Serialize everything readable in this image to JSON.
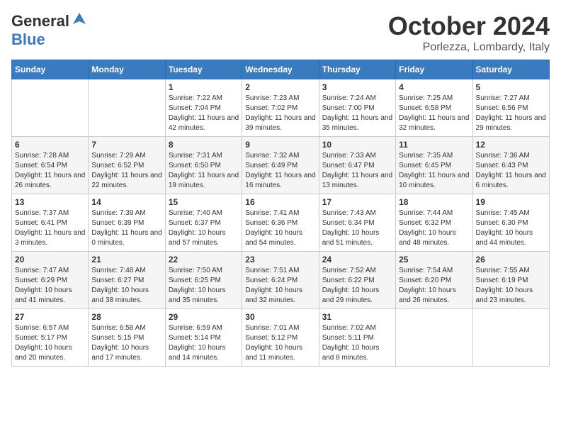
{
  "logo": {
    "general": "General",
    "blue": "Blue"
  },
  "title": "October 2024",
  "location": "Porlezza, Lombardy, Italy",
  "days": [
    "Sunday",
    "Monday",
    "Tuesday",
    "Wednesday",
    "Thursday",
    "Friday",
    "Saturday"
  ],
  "weeks": [
    [
      {
        "day": "",
        "content": ""
      },
      {
        "day": "",
        "content": ""
      },
      {
        "day": "1",
        "content": "Sunrise: 7:22 AM\nSunset: 7:04 PM\nDaylight: 11 hours and 42 minutes."
      },
      {
        "day": "2",
        "content": "Sunrise: 7:23 AM\nSunset: 7:02 PM\nDaylight: 11 hours and 39 minutes."
      },
      {
        "day": "3",
        "content": "Sunrise: 7:24 AM\nSunset: 7:00 PM\nDaylight: 11 hours and 35 minutes."
      },
      {
        "day": "4",
        "content": "Sunrise: 7:25 AM\nSunset: 6:58 PM\nDaylight: 11 hours and 32 minutes."
      },
      {
        "day": "5",
        "content": "Sunrise: 7:27 AM\nSunset: 6:56 PM\nDaylight: 11 hours and 29 minutes."
      }
    ],
    [
      {
        "day": "6",
        "content": "Sunrise: 7:28 AM\nSunset: 6:54 PM\nDaylight: 11 hours and 26 minutes."
      },
      {
        "day": "7",
        "content": "Sunrise: 7:29 AM\nSunset: 6:52 PM\nDaylight: 11 hours and 22 minutes."
      },
      {
        "day": "8",
        "content": "Sunrise: 7:31 AM\nSunset: 6:50 PM\nDaylight: 11 hours and 19 minutes."
      },
      {
        "day": "9",
        "content": "Sunrise: 7:32 AM\nSunset: 6:49 PM\nDaylight: 11 hours and 16 minutes."
      },
      {
        "day": "10",
        "content": "Sunrise: 7:33 AM\nSunset: 6:47 PM\nDaylight: 11 hours and 13 minutes."
      },
      {
        "day": "11",
        "content": "Sunrise: 7:35 AM\nSunset: 6:45 PM\nDaylight: 11 hours and 10 minutes."
      },
      {
        "day": "12",
        "content": "Sunrise: 7:36 AM\nSunset: 6:43 PM\nDaylight: 11 hours and 6 minutes."
      }
    ],
    [
      {
        "day": "13",
        "content": "Sunrise: 7:37 AM\nSunset: 6:41 PM\nDaylight: 11 hours and 3 minutes."
      },
      {
        "day": "14",
        "content": "Sunrise: 7:39 AM\nSunset: 6:39 PM\nDaylight: 11 hours and 0 minutes."
      },
      {
        "day": "15",
        "content": "Sunrise: 7:40 AM\nSunset: 6:37 PM\nDaylight: 10 hours and 57 minutes."
      },
      {
        "day": "16",
        "content": "Sunrise: 7:41 AM\nSunset: 6:36 PM\nDaylight: 10 hours and 54 minutes."
      },
      {
        "day": "17",
        "content": "Sunrise: 7:43 AM\nSunset: 6:34 PM\nDaylight: 10 hours and 51 minutes."
      },
      {
        "day": "18",
        "content": "Sunrise: 7:44 AM\nSunset: 6:32 PM\nDaylight: 10 hours and 48 minutes."
      },
      {
        "day": "19",
        "content": "Sunrise: 7:45 AM\nSunset: 6:30 PM\nDaylight: 10 hours and 44 minutes."
      }
    ],
    [
      {
        "day": "20",
        "content": "Sunrise: 7:47 AM\nSunset: 6:29 PM\nDaylight: 10 hours and 41 minutes."
      },
      {
        "day": "21",
        "content": "Sunrise: 7:48 AM\nSunset: 6:27 PM\nDaylight: 10 hours and 38 minutes."
      },
      {
        "day": "22",
        "content": "Sunrise: 7:50 AM\nSunset: 6:25 PM\nDaylight: 10 hours and 35 minutes."
      },
      {
        "day": "23",
        "content": "Sunrise: 7:51 AM\nSunset: 6:24 PM\nDaylight: 10 hours and 32 minutes."
      },
      {
        "day": "24",
        "content": "Sunrise: 7:52 AM\nSunset: 6:22 PM\nDaylight: 10 hours and 29 minutes."
      },
      {
        "day": "25",
        "content": "Sunrise: 7:54 AM\nSunset: 6:20 PM\nDaylight: 10 hours and 26 minutes."
      },
      {
        "day": "26",
        "content": "Sunrise: 7:55 AM\nSunset: 6:19 PM\nDaylight: 10 hours and 23 minutes."
      }
    ],
    [
      {
        "day": "27",
        "content": "Sunrise: 6:57 AM\nSunset: 5:17 PM\nDaylight: 10 hours and 20 minutes."
      },
      {
        "day": "28",
        "content": "Sunrise: 6:58 AM\nSunset: 5:15 PM\nDaylight: 10 hours and 17 minutes."
      },
      {
        "day": "29",
        "content": "Sunrise: 6:59 AM\nSunset: 5:14 PM\nDaylight: 10 hours and 14 minutes."
      },
      {
        "day": "30",
        "content": "Sunrise: 7:01 AM\nSunset: 5:12 PM\nDaylight: 10 hours and 11 minutes."
      },
      {
        "day": "31",
        "content": "Sunrise: 7:02 AM\nSunset: 5:11 PM\nDaylight: 10 hours and 8 minutes."
      },
      {
        "day": "",
        "content": ""
      },
      {
        "day": "",
        "content": ""
      }
    ]
  ]
}
